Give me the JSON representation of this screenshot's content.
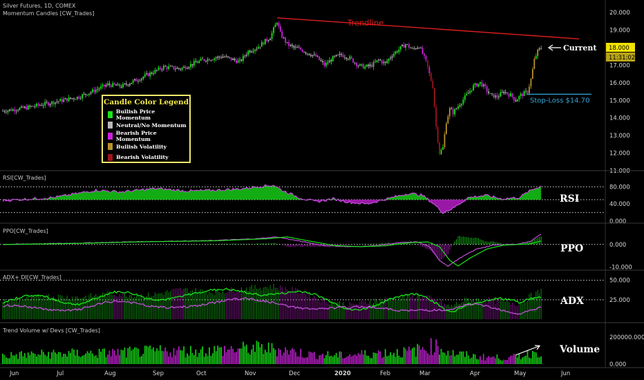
{
  "header": {
    "symbol_line": "Silver Futures, 1D, COMEX",
    "indicator_line": "Momentum Candles [CW_Trades]"
  },
  "legend": {
    "title": "Candle Color Legend",
    "items": [
      {
        "label": "Bullish Price Momentum",
        "color": "#19e619"
      },
      {
        "label": "Neutral/No Momentum",
        "color": "#b8b8b8"
      },
      {
        "label": "Bearish Price Momentum",
        "color": "#cc22dd"
      },
      {
        "label": "Bullish Volatility",
        "color": "#b8932c"
      },
      {
        "label": "Bearish Volatility",
        "color": "#a0141e"
      }
    ]
  },
  "colors": {
    "bull": "#19e619",
    "neutral": "#b8b8b8",
    "bear": "#cc22dd",
    "bull_vol": "#b8932c",
    "bear_vol": "#a0141e",
    "trend": "#e01d1d",
    "stop": "#35a7d6",
    "price_tag": "#f2e300",
    "time_tag": "#b8a417",
    "axis_text": "#d8d8d8",
    "rsi_line": "#c14fd8",
    "ppo_line": "#c14fd8"
  },
  "price_panel": {
    "trendline_label": "Trendline",
    "current_label": "Current",
    "stop_label": "Stop-Loss $14.70",
    "price_tag": "18.000",
    "time_tag": "11:31:02",
    "stop_price": 15.35
  },
  "chart_data": [
    {
      "type": "candlestick",
      "name": "price",
      "title": "Silver Futures, 1D, COMEX",
      "ylim": [
        11.0,
        20.4
      ],
      "yticks": [
        "11.000",
        "12.000",
        "13.000",
        "14.000",
        "15.000",
        "16.000",
        "17.000",
        "18.000",
        "19.000",
        "20.000"
      ],
      "xticks": [
        "Jun",
        "Jul",
        "Aug",
        "Sep",
        "Oct",
        "Nov",
        "Dec",
        "2020",
        "Feb",
        "Mar",
        "Apr",
        "May",
        "Jun"
      ],
      "close_path": [
        [
          0,
          14.4
        ],
        [
          15,
          14.6
        ],
        [
          30,
          14.9
        ],
        [
          45,
          15.2
        ],
        [
          55,
          15.6
        ],
        [
          62,
          15.9
        ],
        [
          70,
          15.8
        ],
        [
          80,
          16.2
        ],
        [
          95,
          16.9
        ],
        [
          105,
          16.8
        ],
        [
          118,
          17.3
        ],
        [
          130,
          17.5
        ],
        [
          140,
          17.2
        ],
        [
          145,
          17.8
        ],
        [
          150,
          18.0
        ],
        [
          158,
          18.6
        ],
        [
          162,
          19.5
        ],
        [
          164,
          18.8
        ],
        [
          168,
          18.2
        ],
        [
          172,
          18.0
        ],
        [
          176,
          17.9
        ],
        [
          180,
          17.7
        ],
        [
          185,
          17.5
        ],
        [
          190,
          17.0
        ],
        [
          195,
          17.4
        ],
        [
          200,
          17.6
        ],
        [
          205,
          17.4
        ],
        [
          210,
          17.0
        ],
        [
          214,
          16.9
        ],
        [
          218,
          17.0
        ],
        [
          222,
          17.3
        ],
        [
          226,
          17.1
        ],
        [
          230,
          17.6
        ],
        [
          234,
          17.9
        ],
        [
          238,
          18.2
        ],
        [
          242,
          17.9
        ],
        [
          246,
          18.1
        ],
        [
          250,
          17.2
        ],
        [
          254,
          15.8
        ],
        [
          256,
          13.5
        ],
        [
          258,
          12.0
        ],
        [
          260,
          12.3
        ],
        [
          262,
          13.8
        ],
        [
          264,
          14.5
        ],
        [
          266,
          14.3
        ],
        [
          270,
          14.8
        ],
        [
          274,
          15.3
        ],
        [
          278,
          15.8
        ],
        [
          282,
          16.0
        ],
        [
          285,
          15.7
        ],
        [
          288,
          15.3
        ],
        [
          292,
          15.2
        ],
        [
          296,
          15.5
        ],
        [
          300,
          15.3
        ],
        [
          303,
          15.0
        ],
        [
          306,
          15.3
        ],
        [
          310,
          15.5
        ],
        [
          312,
          16.2
        ],
        [
          314,
          17.3
        ],
        [
          316,
          17.8
        ],
        [
          318,
          18.0
        ]
      ],
      "trendline": {
        "from": [
          162,
          19.7
        ],
        "to": [
          318,
          18.5
        ]
      },
      "annotation": "Trendline"
    },
    {
      "type": "line",
      "name": "RSI",
      "title": "RSI[CW_Trades]",
      "ylim": [
        0,
        100
      ],
      "yticks": [
        "0.000",
        "40.000",
        "80.000"
      ],
      "levels": [
        80,
        50,
        20
      ],
      "series_path": [
        [
          0,
          48
        ],
        [
          30,
          55
        ],
        [
          45,
          65
        ],
        [
          55,
          72
        ],
        [
          70,
          68
        ],
        [
          90,
          76
        ],
        [
          110,
          70
        ],
        [
          125,
          72
        ],
        [
          140,
          75
        ],
        [
          150,
          80
        ],
        [
          160,
          84
        ],
        [
          165,
          72
        ],
        [
          175,
          55
        ],
        [
          185,
          45
        ],
        [
          195,
          52
        ],
        [
          205,
          44
        ],
        [
          215,
          40
        ],
        [
          230,
          55
        ],
        [
          240,
          65
        ],
        [
          248,
          60
        ],
        [
          254,
          42
        ],
        [
          260,
          20
        ],
        [
          266,
          30
        ],
        [
          275,
          55
        ],
        [
          285,
          60
        ],
        [
          295,
          52
        ],
        [
          305,
          55
        ],
        [
          312,
          72
        ],
        [
          318,
          82
        ]
      ]
    },
    {
      "type": "line",
      "name": "PPO",
      "title": "PPO[CW_Trades]",
      "ylim": [
        -11,
        6
      ],
      "yticks": [
        "-10.000",
        "0.000"
      ],
      "levels": [
        0
      ],
      "series_path": [
        [
          0,
          0
        ],
        [
          40,
          0.5
        ],
        [
          80,
          1.2
        ],
        [
          120,
          1.6
        ],
        [
          150,
          2.5
        ],
        [
          162,
          3.3
        ],
        [
          175,
          1.5
        ],
        [
          190,
          -0.5
        ],
        [
          205,
          -1.0
        ],
        [
          220,
          -0.6
        ],
        [
          235,
          0.8
        ],
        [
          245,
          1.1
        ],
        [
          252,
          -1.0
        ],
        [
          258,
          -7.0
        ],
        [
          263,
          -9.5
        ],
        [
          270,
          -6.0
        ],
        [
          280,
          -2.0
        ],
        [
          290,
          -0.3
        ],
        [
          305,
          0.2
        ],
        [
          312,
          1.5
        ],
        [
          318,
          4.5
        ]
      ]
    },
    {
      "type": "line",
      "name": "ADX+ DI",
      "title": "ADX+ DI[CW_Trades]",
      "ylim": [
        0,
        55
      ],
      "yticks": [
        "25.000",
        "50.000"
      ],
      "levels": [
        50,
        25
      ],
      "series_path": [
        [
          0,
          22
        ],
        [
          25,
          30
        ],
        [
          45,
          28
        ],
        [
          65,
          33
        ],
        [
          85,
          30
        ],
        [
          105,
          38
        ],
        [
          125,
          35
        ],
        [
          145,
          40
        ],
        [
          160,
          42
        ],
        [
          175,
          36
        ],
        [
          190,
          24
        ],
        [
          205,
          18
        ],
        [
          220,
          24
        ],
        [
          235,
          28
        ],
        [
          248,
          30
        ],
        [
          258,
          22
        ],
        [
          264,
          16
        ],
        [
          275,
          26
        ],
        [
          290,
          24
        ],
        [
          305,
          20
        ],
        [
          312,
          30
        ],
        [
          318,
          36
        ]
      ]
    },
    {
      "type": "bar",
      "name": "Volume",
      "title": "Trend Volume w/ Devs [CW_Trades]",
      "ylim": [
        0,
        250000
      ],
      "yticks": [
        "0.000",
        "200000.000"
      ],
      "series_path": [
        [
          0,
          70000
        ],
        [
          30,
          85000
        ],
        [
          60,
          90000
        ],
        [
          90,
          105000
        ],
        [
          120,
          110000
        ],
        [
          150,
          130000
        ],
        [
          165,
          120000
        ],
        [
          180,
          80000
        ],
        [
          200,
          70000
        ],
        [
          220,
          90000
        ],
        [
          240,
          100000
        ],
        [
          255,
          150000
        ],
        [
          265,
          90000
        ],
        [
          280,
          60000
        ],
        [
          300,
          50000
        ],
        [
          318,
          110000
        ]
      ]
    }
  ],
  "panel_labels": {
    "rsi_title": "RSI[CW_Trades]",
    "rsi_big": "RSI",
    "ppo_title": "PPO[CW_Trades]",
    "ppo_big": "PPO",
    "adx_title": "ADX+ DI[CW_Trades]",
    "adx_big": "ADX",
    "vol_title": "Trend Volume w/ Devs [CW_Trades]",
    "vol_big": "Volume"
  }
}
